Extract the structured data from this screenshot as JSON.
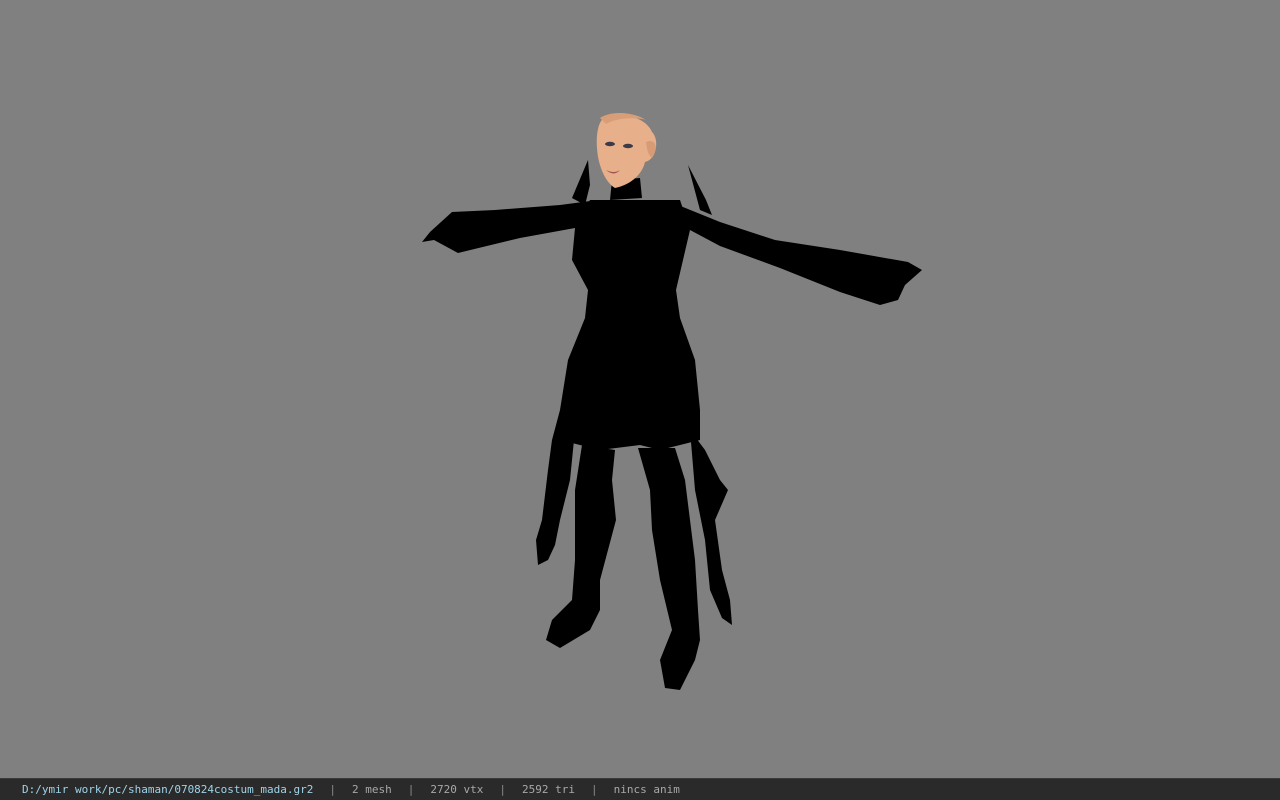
{
  "viewport": {
    "background_color": "#808080",
    "model_silhouette_color": "#000000",
    "skin_color": "#e8b08a"
  },
  "statusbar": {
    "file_path": "D:/ymir work/pc/shaman/070824costum_mada.gr2",
    "mesh": "2 mesh",
    "vertices": "2720 vtx",
    "triangles": "2592 tri",
    "anim": "nincs anim",
    "separator": "|"
  }
}
